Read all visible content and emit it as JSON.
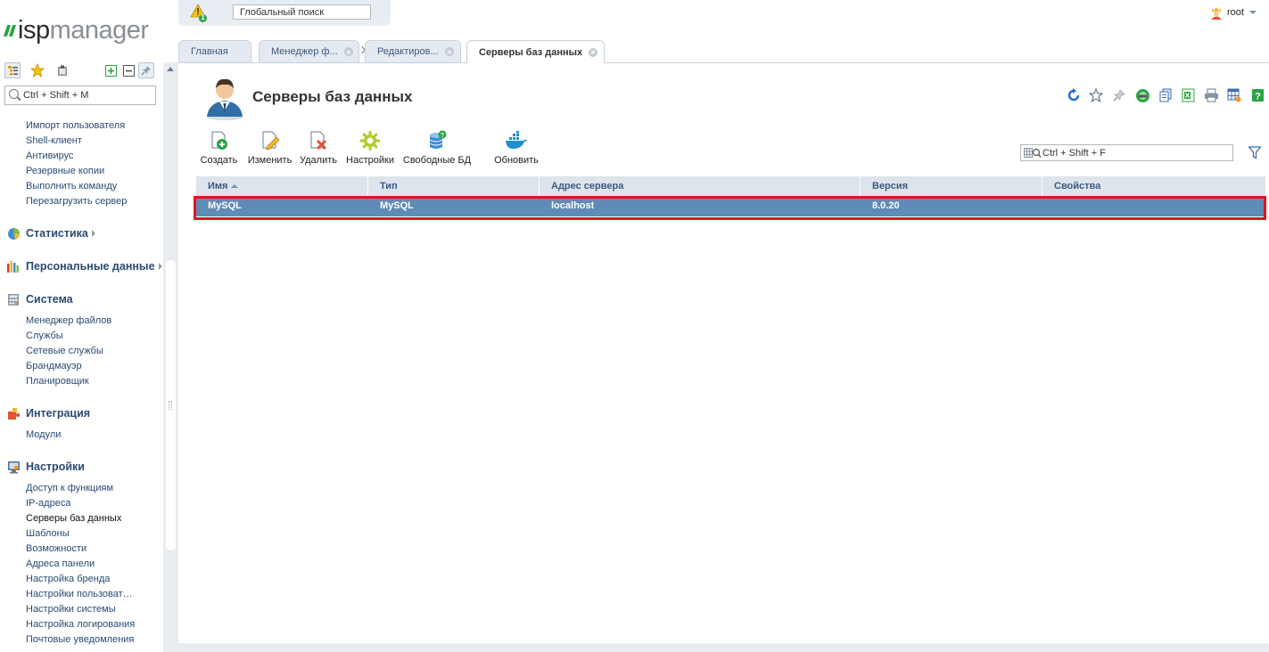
{
  "app": {
    "logo_left": "isp",
    "logo_right": "manager"
  },
  "topbar": {
    "warning_count": "1",
    "global_search_placeholder": "Глобальный поиск",
    "user": "root"
  },
  "sidebar": {
    "search_placeholder": "Ctrl + Shift + M",
    "items_top": [
      "Импорт пользователя",
      "Shell-клиент",
      "Антивирус",
      "Резервные копии",
      "Выполнить команду",
      "Перезагрузить сервер"
    ],
    "sections": {
      "stats": "Статистика",
      "personal": "Персональные данные",
      "system": "Система",
      "integration": "Интеграция",
      "settings": "Настройки"
    },
    "system_items": [
      "Менеджер файлов",
      "Службы",
      "Сетевые службы",
      "Брандмауэр",
      "Планировщик"
    ],
    "integration_items": [
      "Модули"
    ],
    "settings_items": [
      "Доступ к функциям",
      "IP-адреса",
      "Серверы баз данных",
      "Шаблоны",
      "Возможности",
      "Адреса панели",
      "Настройка бренда",
      "Настройки пользоват…",
      "Настройки системы",
      "Настройка логирования",
      "Почтовые уведомления"
    ]
  },
  "tabs": [
    {
      "label": "Главная"
    },
    {
      "label": "Менеджер ф..."
    },
    {
      "label": "Редактиров..."
    },
    {
      "label": "Серверы баз данных"
    }
  ],
  "page": {
    "title": "Серверы баз данных",
    "toolbar": [
      "Создать",
      "Изменить",
      "Удалить",
      "Настройки",
      "Свободные БД",
      "Обновить"
    ],
    "filter_placeholder": "Ctrl + Shift + F"
  },
  "table": {
    "columns": [
      "Имя",
      "Тип",
      "Адрес сервера",
      "Версия",
      "Свойства"
    ],
    "rows": [
      [
        "MySQL",
        "MySQL",
        "localhost",
        "8.0.20",
        ""
      ]
    ]
  },
  "colors": {
    "accent_green": "#2ba343",
    "selected_row": "#5f8cb6",
    "highlight_frame": "#e0151d",
    "link": "#2a4a73"
  }
}
